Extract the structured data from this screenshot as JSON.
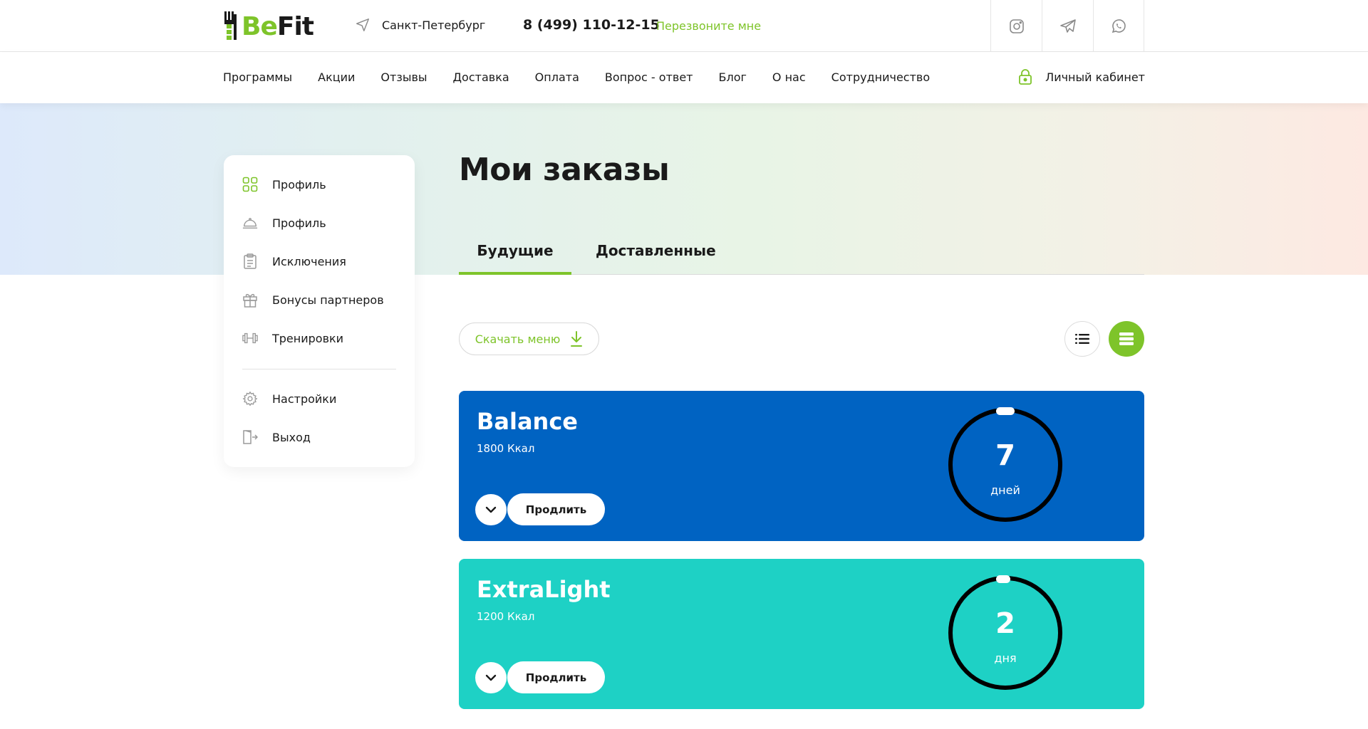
{
  "header": {
    "logo": {
      "be": "Be",
      "fit": "Fit"
    },
    "city": "Санкт-Петербург",
    "phone": "8 (499) 110-12-15",
    "callback": "Перезвоните мне",
    "socials": [
      "instagram-icon",
      "telegram-icon",
      "whatsapp-icon"
    ]
  },
  "nav": {
    "items": [
      "Программы",
      "Акции",
      "Отзывы",
      "Доставка",
      "Оплата",
      "Вопрос - ответ",
      "Блог",
      "О нас",
      "Сотрудничество"
    ],
    "cabinet": "Личный кабинет"
  },
  "sidebar": {
    "items": [
      {
        "label": "Профиль",
        "icon": "grid-icon",
        "active": true
      },
      {
        "label": "Профиль",
        "icon": "cloche-icon"
      },
      {
        "label": "Исключения",
        "icon": "clipboard-icon"
      },
      {
        "label": "Бонусы партнеров",
        "icon": "gift-icon"
      },
      {
        "label": "Тренировки",
        "icon": "dumbbell-icon"
      }
    ],
    "bottom": [
      {
        "label": "Настройки",
        "icon": "gear-icon"
      },
      {
        "label": "Выход",
        "icon": "logout-icon"
      }
    ]
  },
  "main": {
    "title": "Мои заказы",
    "tabs": [
      {
        "label": "Будущие",
        "active": true
      },
      {
        "label": "Доставленные"
      }
    ],
    "download_label": "Скачать меню",
    "orders": [
      {
        "name": "Balance",
        "kcal": "1800 Ккал",
        "extend": "Продлить",
        "days": "7",
        "days_unit": "дней",
        "color": "#0063c2"
      },
      {
        "name": "ExtraLight",
        "kcal": "1200 Ккал",
        "extend": "Продлить",
        "days": "2",
        "days_unit": "дня",
        "color": "#1ed1c5"
      }
    ]
  },
  "colors": {
    "accent": "#7ec42a",
    "text": "#1a1a1a"
  }
}
